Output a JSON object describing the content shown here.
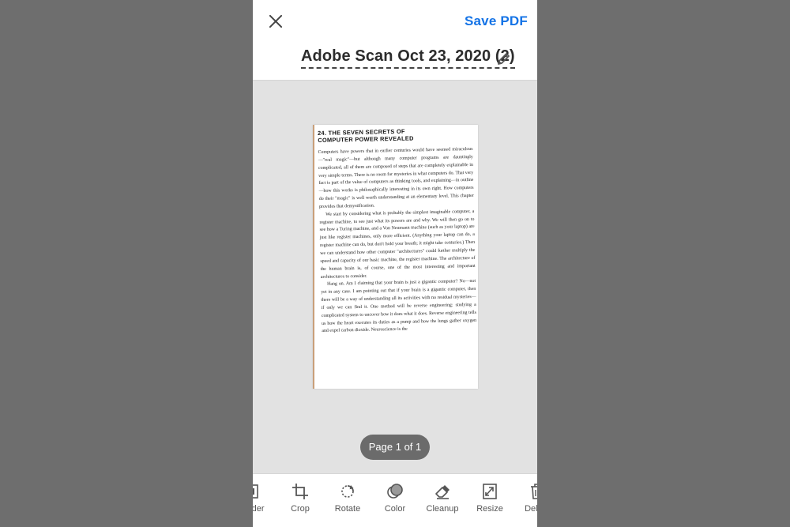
{
  "header": {
    "save_label": "Save PDF",
    "document_title": "Adobe Scan Oct 23, 2020 (2)"
  },
  "page": {
    "heading_line1": "24. THE SEVEN SECRETS OF",
    "heading_line2": "COMPUTER POWER REVEALED",
    "paragraph1": "Computers have powers that in earlier centuries would have seemed miraculous—\"real magic\"—but although many computer programs are dauntingly complicated, all of them are composed of steps that are completely explainable in very simple terms. There is no room for mysteries in what computers do. That very fact is part of the value of computers as thinking tools, and explaining—in outline—how this works is philosophically interesting in its own right. How computers do their \"magic\" is well worth understanding at an elementary level. This chapter provides that demystification.",
    "paragraph2": "We start by considering what is probably the simplest imaginable computer, a register machine, to see just what its powers are and why. We will then go on to see how a Turing machine, and a Von Neumann machine (such as your laptop) are just like register machines, only more efficient. (Anything your laptop can do, a register machine can do, but don't hold your breath; it might take centuries.) Then we can understand how other computer \"architectures\" could further multiply the speed and capacity of our basic machine, the register machine. The architecture of the human brain is, of course, one of the most interesting and important architectures to consider.",
    "paragraph3": "Hang on. Am I claiming that your brain is just a gigantic computer? No—not yet in any case. I am pointing out that if your brain is a gigantic computer, then there will be a way of understanding all its activities with no residual mysteries—if only we can find it. One method will be reverse engineering: studying a complicated system to uncover how it does what it does. Reverse engineering tells us how the heart executes its duties as a pump and how the lungs gather oxygen and expel carbon dioxide. Neuroscience is the"
  },
  "page_indicator": "Page 1 of 1",
  "toolbar": {
    "items": [
      {
        "label": "Border",
        "icon": "border-icon"
      },
      {
        "label": "Crop",
        "icon": "crop-icon"
      },
      {
        "label": "Rotate",
        "icon": "rotate-icon"
      },
      {
        "label": "Color",
        "icon": "color-icon"
      },
      {
        "label": "Cleanup",
        "icon": "eraser-icon"
      },
      {
        "label": "Resize",
        "icon": "resize-icon"
      },
      {
        "label": "Delete",
        "icon": "trash-icon"
      }
    ]
  },
  "colors": {
    "accent": "#1473e6",
    "backdrop": "#6e6e6e",
    "canvas": "#e2e2e2",
    "pill": "#6b6b6b"
  }
}
